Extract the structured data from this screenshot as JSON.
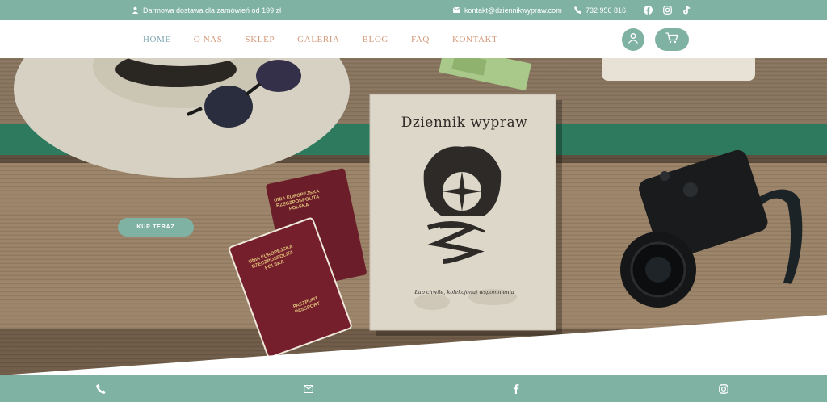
{
  "topbar": {
    "promo_text": "Darmowa dostawa dla zamówień od 199 zł",
    "email": "kontakt@dziennikwypraw.com",
    "phone": "732 956 816",
    "socials": [
      "facebook-icon",
      "instagram-icon",
      "tiktok-icon"
    ]
  },
  "nav": {
    "items": [
      {
        "label": "HOME",
        "active": true
      },
      {
        "label": "O NAS",
        "active": false
      },
      {
        "label": "SKLEP",
        "active": false
      },
      {
        "label": "GALERIA",
        "active": false
      },
      {
        "label": "BLOG",
        "active": false
      },
      {
        "label": "FAQ",
        "active": false
      },
      {
        "label": "KONTAKT",
        "active": false
      }
    ],
    "icons": [
      "user-icon",
      "cart-icon"
    ]
  },
  "hero": {
    "cta_label": "KUP TERAZ",
    "book_title": "Dziennik wypraw",
    "book_subtitle": "Łap chwile, kolekcjonuj wspomnienia",
    "passport_top": "UNIA EUROPEJSKA RZECZPOSPOLITA POLSKA",
    "passport_bottom": "PASZPORT PASSPORT"
  },
  "footer": {
    "icons": [
      "phone-icon",
      "mail-icon",
      "facebook-icon",
      "instagram-icon"
    ]
  },
  "colors": {
    "brand_teal": "#7fb2a3",
    "nav_text": "#d49a7a",
    "nav_active": "#7fa9b3"
  }
}
